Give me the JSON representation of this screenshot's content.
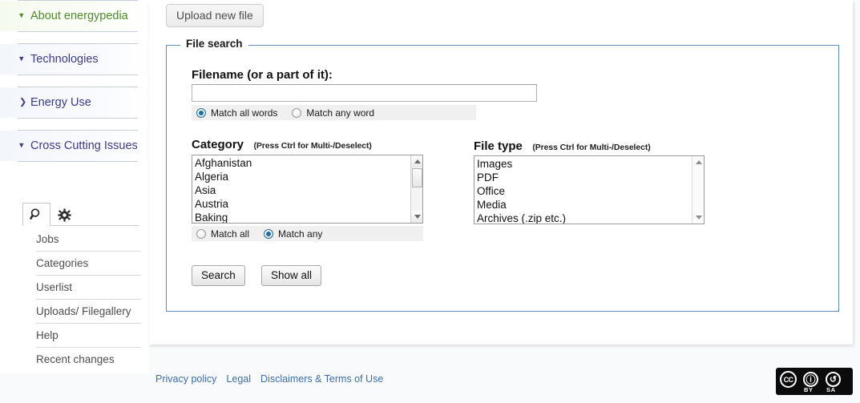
{
  "sidebar": {
    "nav": [
      {
        "label": "About energypedia",
        "caret": "chevron-down-icon",
        "style": "green"
      },
      {
        "label": "Technologies",
        "caret": "chevron-down-icon",
        "style": "blue"
      },
      {
        "label": "Energy Use",
        "caret": "chevron-right-icon",
        "style": "blue"
      },
      {
        "label": "Cross Cutting Issues",
        "caret": "chevron-down-icon",
        "style": "blue"
      }
    ],
    "tabs": [
      {
        "name": "search-tab",
        "icon": "magnifier-icon",
        "active": true
      },
      {
        "name": "settings-tab",
        "icon": "gear-icon",
        "active": false
      }
    ],
    "menu": [
      {
        "label": "Jobs"
      },
      {
        "label": "Categories"
      },
      {
        "label": "Userlist"
      },
      {
        "label": "Uploads/ Filegallery"
      },
      {
        "label": "Help"
      },
      {
        "label": "Recent changes"
      }
    ]
  },
  "content": {
    "upload_button": "Upload new file",
    "fieldset_legend": "File search",
    "filename": {
      "label": "Filename (or a part of it):",
      "value": "",
      "placeholder": ""
    },
    "filename_match": {
      "options": [
        {
          "label": "Match all words",
          "checked": true
        },
        {
          "label": "Match any word",
          "checked": false
        }
      ]
    },
    "category": {
      "label": "Category",
      "hint": "(Press Ctrl for Multi-/Deselect)",
      "items": [
        "Afghanistan",
        "Algeria",
        "Asia",
        "Austria",
        "Baking"
      ],
      "match": [
        {
          "label": "Match all",
          "checked": false
        },
        {
          "label": "Match any",
          "checked": true
        }
      ]
    },
    "filetype": {
      "label": "File type",
      "hint": "(Press Ctrl for Multi-/Deselect)",
      "items": [
        "Images",
        "PDF",
        "Office",
        "Media",
        "Archives (.zip etc.)"
      ]
    },
    "buttons": {
      "search": "Search",
      "show_all": "Show all"
    }
  },
  "footer": {
    "links": [
      "Privacy policy",
      "Legal",
      "Disclaimers & Terms of Use"
    ],
    "license": {
      "name": "cc-by-sa-badge",
      "main": "CC",
      "by_glyph": "i",
      "sa_glyph": "ɔ",
      "by_caption": "BY",
      "sa_caption": "SA"
    }
  },
  "colors": {
    "accent_green": "#4f8a2e",
    "nav_blue": "#3c3c80",
    "fieldset_border": "#5d8db5",
    "link_blue": "#3a6ea5",
    "radio_fill": "#1d6f99",
    "page_bg": "#f9fafc"
  }
}
